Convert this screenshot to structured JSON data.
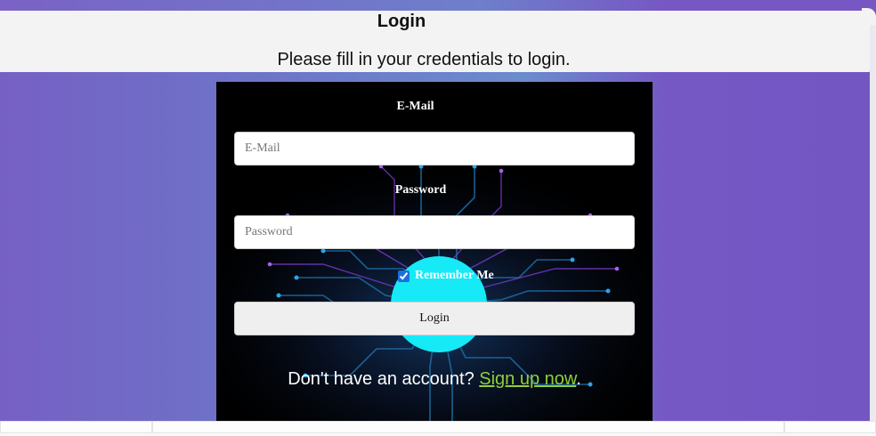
{
  "header": {
    "title": "Login",
    "subtitle": "Please fill in your credentials to login."
  },
  "form": {
    "email_label": "E-Mail",
    "email_placeholder": "E-Mail",
    "email_value": "",
    "password_label": "Password",
    "password_placeholder": "Password",
    "password_value": "",
    "remember_label": "Remember Me",
    "remember_checked": true,
    "login_button": "Login"
  },
  "signup": {
    "prefix": "Don't have an account? ",
    "link_text": "Sign up now",
    "suffix": "."
  },
  "colors": {
    "background_gradient": [
      "#7660c4",
      "#6a8ccd",
      "#7456c3"
    ],
    "accent_circle": "#16eaf7",
    "link": "#8fcf3a",
    "card_bg": "#000000"
  }
}
